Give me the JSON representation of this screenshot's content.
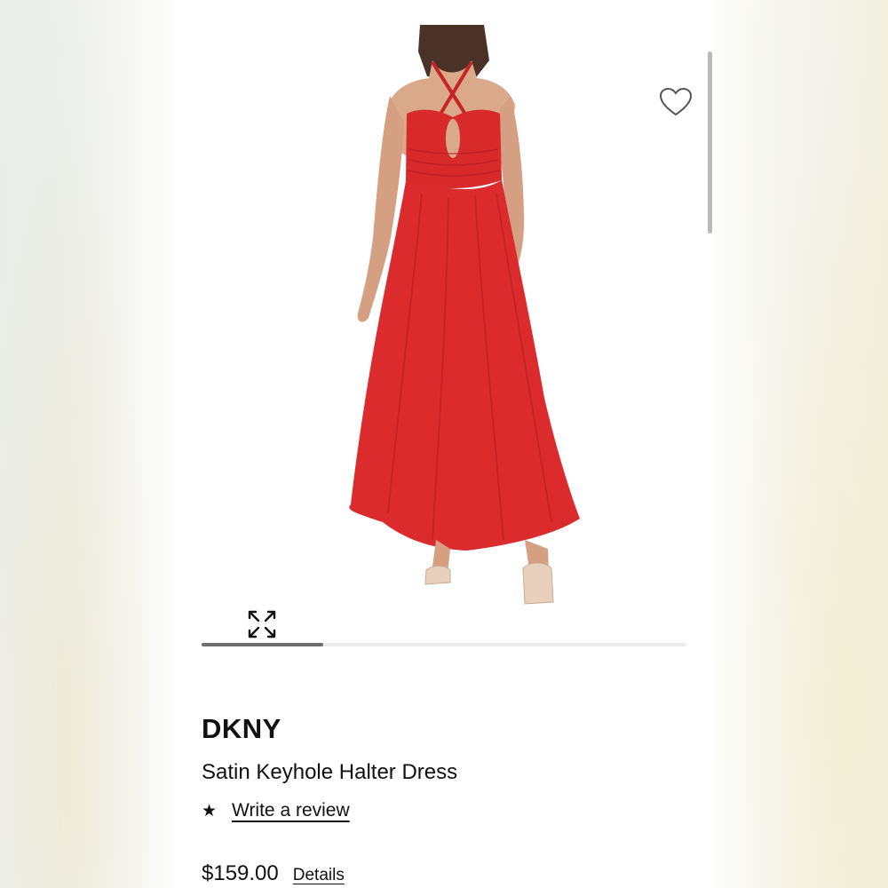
{
  "product": {
    "brand": "DKNY",
    "name": "Satin Keyhole Halter Dress",
    "review_link": "Write a review",
    "price": "$159.00",
    "details_link": "Details",
    "rating_icon": "star-icon"
  },
  "gallery": {
    "image_subject": "red-halter-dress-photo",
    "progress_fraction": 0.25,
    "favorite_icon": "heart-icon",
    "expand_icon": "expand-arrows-icon"
  },
  "colors": {
    "dress_red": "#dc2b2d",
    "text": "#111111",
    "progress_fill": "#6e6e6e",
    "progress_track": "#ececec"
  }
}
